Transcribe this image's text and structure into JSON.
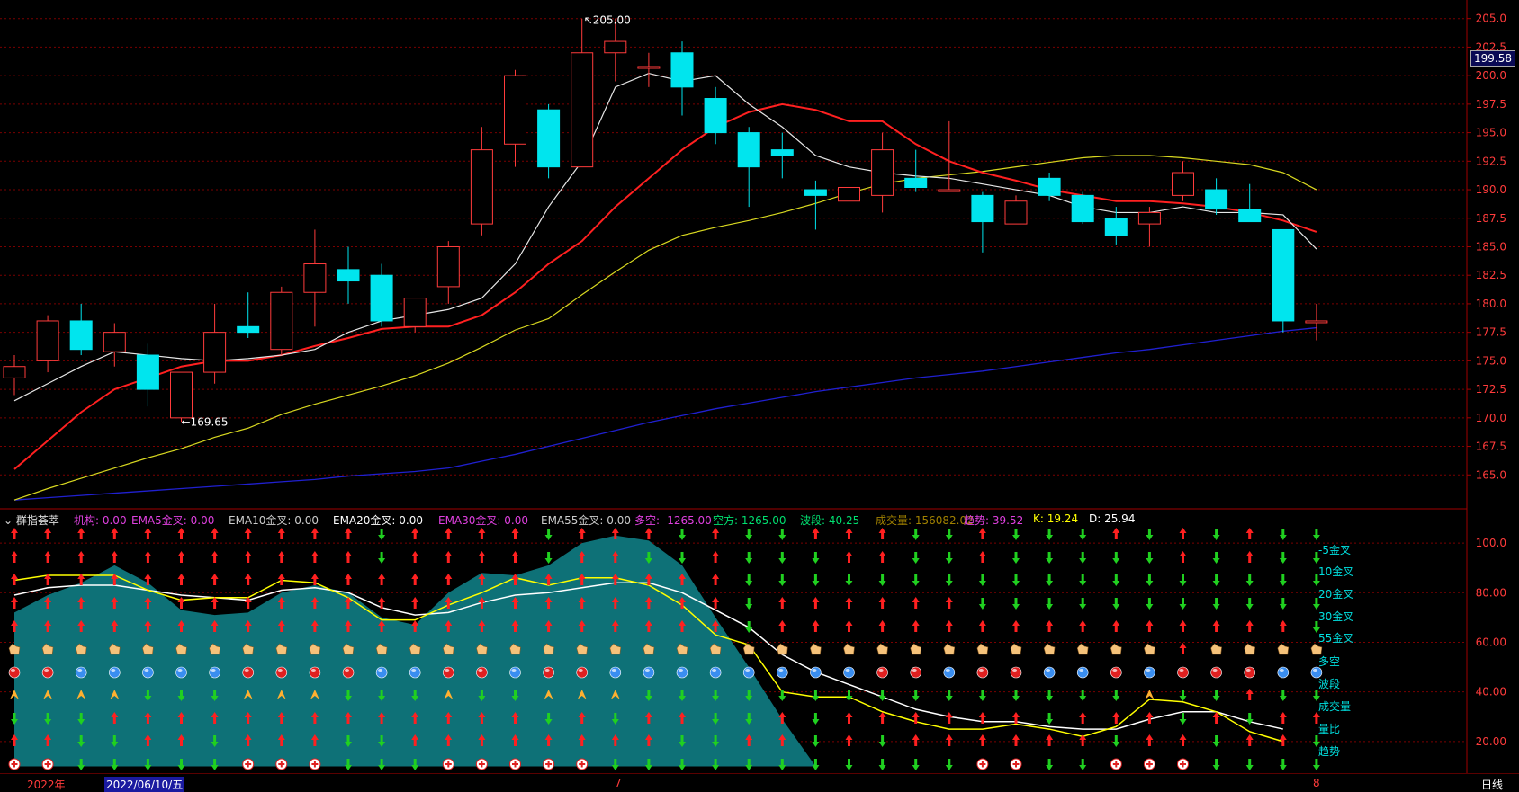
{
  "colors": {
    "up": "#ff3b3b",
    "down": "#00e5ee",
    "ma5": "#e6e6e6",
    "ma10": "#ff2020",
    "ma20": "#d8d820",
    "ma60": "#2020d0",
    "grid": "#7a0000"
  },
  "main": {
    "y_ticks": [
      "205.0",
      "202.5",
      "200.0",
      "197.5",
      "195.0",
      "192.5",
      "190.0",
      "187.5",
      "185.0",
      "182.5",
      "180.0",
      "177.5",
      "175.0",
      "172.5",
      "170.0",
      "167.5",
      "165.0"
    ],
    "current_price": "199.58",
    "high_label": "205.00",
    "low_label": "169.65",
    "high_arrow": "↖",
    "low_arrow": "←"
  },
  "legend": {
    "indicator_name": "群指荟萃",
    "items": [
      {
        "text": "机构: 0.00",
        "color": "#e040e0"
      },
      {
        "text": "EMA5金叉: 0.00",
        "color": "#e040e0"
      },
      {
        "text": "EMA10金叉: 0.00",
        "color": "#cccccc"
      },
      {
        "text": "EMA20金叉: 0.00",
        "color": "#ffffff"
      },
      {
        "text": "EMA30金叉: 0.00",
        "color": "#e040e0"
      },
      {
        "text": "EMA55金叉: 0.00",
        "color": "#cccccc"
      },
      {
        "text": "多空: -1265.00",
        "color": "#e040e0"
      },
      {
        "text": "空方: 1265.00",
        "color": "#00e070"
      },
      {
        "text": "波段: 40.25",
        "color": "#00e070"
      },
      {
        "text": "成交量: 156082.02",
        "color": "#a08000"
      },
      {
        "text": "趋势: 39.52",
        "color": "#e040e0"
      },
      {
        "text": "K: 19.24",
        "color": "#ffff00"
      },
      {
        "text": "D: 25.94",
        "color": "#ffffff"
      }
    ]
  },
  "sub": {
    "y_ticks": [
      "100.0",
      "80.00",
      "60.00",
      "40.00",
      "20.00"
    ],
    "row_labels": [
      "-5金叉",
      "10金叉",
      "20金叉",
      "30金叉",
      "55金叉",
      "多空",
      "波段",
      "成交量",
      "量比",
      "趋势"
    ],
    "row_label_color": "#00e0e0"
  },
  "bottom": {
    "year": "2022年",
    "date": "2022/06/10/五",
    "month7": "7",
    "month8": "8",
    "period": "日线"
  },
  "chart_data": [
    {
      "type": "candlestick",
      "ylim": [
        162.5,
        206.0
      ],
      "candles": [
        {
          "o": 173.5,
          "h": 175.5,
          "l": 172.0,
          "c": 174.5
        },
        {
          "o": 175.0,
          "h": 179.0,
          "l": 174.0,
          "c": 178.5
        },
        {
          "o": 178.5,
          "h": 180.0,
          "l": 175.5,
          "c": 176.0
        },
        {
          "o": 175.8,
          "h": 178.3,
          "l": 174.5,
          "c": 177.5
        },
        {
          "o": 175.5,
          "h": 176.5,
          "l": 171.0,
          "c": 172.5
        },
        {
          "o": 170.0,
          "h": 174.0,
          "l": 169.65,
          "c": 174.0
        },
        {
          "o": 174.0,
          "h": 180.0,
          "l": 173.0,
          "c": 177.5
        },
        {
          "o": 178.0,
          "h": 181.0,
          "l": 177.0,
          "c": 177.5
        },
        {
          "o": 176.0,
          "h": 181.5,
          "l": 175.5,
          "c": 181.0
        },
        {
          "o": 181.0,
          "h": 186.5,
          "l": 178.0,
          "c": 183.5
        },
        {
          "o": 183.0,
          "h": 185.0,
          "l": 180.0,
          "c": 182.0
        },
        {
          "o": 182.5,
          "h": 183.5,
          "l": 178.0,
          "c": 178.5
        },
        {
          "o": 178.0,
          "h": 180.5,
          "l": 177.5,
          "c": 180.5
        },
        {
          "o": 181.5,
          "h": 185.5,
          "l": 180.0,
          "c": 185.0
        },
        {
          "o": 187.0,
          "h": 195.5,
          "l": 186.0,
          "c": 193.5
        },
        {
          "o": 194.0,
          "h": 200.5,
          "l": 192.0,
          "c": 200.0
        },
        {
          "o": 197.0,
          "h": 197.5,
          "l": 191.0,
          "c": 192.0
        },
        {
          "o": 192.0,
          "h": 205.0,
          "l": 192.0,
          "c": 202.0
        },
        {
          "o": 202.0,
          "h": 205.0,
          "l": 199.5,
          "c": 203.0
        },
        {
          "o": 200.8,
          "h": 202.0,
          "l": 199.0,
          "c": 200.8
        },
        {
          "o": 202.0,
          "h": 203.0,
          "l": 196.5,
          "c": 199.0
        },
        {
          "o": 198.0,
          "h": 199.0,
          "l": 194.0,
          "c": 195.0
        },
        {
          "o": 195.0,
          "h": 195.5,
          "l": 188.5,
          "c": 192.0
        },
        {
          "o": 193.5,
          "h": 195.0,
          "l": 191.0,
          "c": 193.0
        },
        {
          "o": 190.0,
          "h": 190.8,
          "l": 186.5,
          "c": 189.5
        },
        {
          "o": 189.0,
          "h": 191.5,
          "l": 188.0,
          "c": 190.2
        },
        {
          "o": 189.5,
          "h": 195.0,
          "l": 188.0,
          "c": 193.5
        },
        {
          "o": 191.0,
          "h": 193.5,
          "l": 189.8,
          "c": 190.2
        },
        {
          "o": 190.0,
          "h": 196.0,
          "l": 190.0,
          "c": 190.0
        },
        {
          "o": 189.5,
          "h": 189.8,
          "l": 184.5,
          "c": 187.2
        },
        {
          "o": 187.0,
          "h": 189.5,
          "l": 187.0,
          "c": 189.0
        },
        {
          "o": 191.0,
          "h": 191.5,
          "l": 189.0,
          "c": 189.5
        },
        {
          "o": 189.5,
          "h": 189.8,
          "l": 187.0,
          "c": 187.2
        },
        {
          "o": 187.5,
          "h": 188.5,
          "l": 185.2,
          "c": 186.0
        },
        {
          "o": 187.0,
          "h": 188.5,
          "l": 185.0,
          "c": 188.0
        },
        {
          "o": 189.5,
          "h": 192.5,
          "l": 189.0,
          "c": 191.5
        },
        {
          "o": 190.0,
          "h": 191.0,
          "l": 187.8,
          "c": 188.3
        },
        {
          "o": 188.3,
          "h": 190.5,
          "l": 187.2,
          "c": 187.2
        },
        {
          "o": 186.5,
          "h": 186.5,
          "l": 177.5,
          "c": 178.5
        },
        {
          "o": 178.5,
          "h": 180.0,
          "l": 176.8,
          "c": 178.5
        }
      ],
      "ma5": [
        171.5,
        173.0,
        174.5,
        175.8,
        175.5,
        175.2,
        175.0,
        175.2,
        175.5,
        176.0,
        177.5,
        178.5,
        179.0,
        179.5,
        180.5,
        183.5,
        188.5,
        192.5,
        199.0,
        200.2,
        199.5,
        200.0,
        197.5,
        195.5,
        193.0,
        192.0,
        191.5,
        191.2,
        191.0,
        190.5,
        190.0,
        189.5,
        188.5,
        188.0,
        188.0,
        188.5,
        188.0,
        188.0,
        187.8,
        184.8
      ],
      "ma10": [
        165.5,
        168.0,
        170.5,
        172.5,
        173.5,
        174.5,
        175.0,
        175.0,
        175.5,
        176.3,
        177.0,
        177.8,
        178.0,
        178.0,
        179.0,
        181.0,
        183.5,
        185.5,
        188.5,
        191.0,
        193.5,
        195.5,
        196.8,
        197.5,
        197.0,
        196.0,
        196.0,
        194.0,
        192.5,
        191.5,
        190.8,
        190.0,
        189.5,
        189.0,
        189.0,
        188.8,
        188.5,
        188.0,
        187.3,
        186.3
      ],
      "ma20": [
        162.8,
        163.8,
        164.7,
        165.6,
        166.5,
        167.3,
        168.3,
        169.1,
        170.3,
        171.2,
        172.0,
        172.8,
        173.7,
        174.8,
        176.2,
        177.7,
        178.7,
        180.8,
        182.8,
        184.7,
        186.0,
        186.7,
        187.3,
        188.0,
        188.8,
        189.7,
        190.5,
        191.0,
        191.3,
        191.6,
        192.0,
        192.4,
        192.8,
        193.0,
        193.0,
        192.8,
        192.5,
        192.2,
        191.5,
        190.0
      ],
      "ma60": [
        162.8,
        163.0,
        163.2,
        163.4,
        163.6,
        163.8,
        164.0,
        164.2,
        164.4,
        164.6,
        164.9,
        165.1,
        165.3,
        165.6,
        166.2,
        166.8,
        167.5,
        168.2,
        168.9,
        169.6,
        170.2,
        170.8,
        171.3,
        171.8,
        172.3,
        172.7,
        173.1,
        173.5,
        173.8,
        174.1,
        174.5,
        174.9,
        175.3,
        175.7,
        176.0,
        176.4,
        176.8,
        177.2,
        177.6,
        177.9
      ]
    },
    {
      "type": "area",
      "ylim": [
        8,
        108
      ],
      "area": [
        72,
        79,
        84,
        91,
        84,
        73,
        71,
        72,
        80,
        83,
        80,
        70,
        67,
        80,
        88,
        87,
        91,
        100,
        103,
        101,
        91,
        70,
        50,
        29,
        10,
        null,
        null,
        null,
        null,
        null,
        null,
        null,
        null,
        null,
        null,
        null,
        null,
        null,
        null,
        null
      ],
      "k": [
        85,
        87,
        87,
        87,
        81,
        77,
        78,
        78,
        85,
        84,
        78,
        69,
        69,
        75,
        80,
        86,
        83,
        86,
        86,
        83,
        75,
        63,
        59,
        40,
        38,
        38,
        32,
        28,
        25,
        25,
        27,
        25,
        22,
        26,
        37,
        36,
        32,
        24,
        20,
        null
      ],
      "d": [
        79,
        82,
        83,
        83,
        81,
        79,
        78,
        77,
        81,
        82,
        80,
        74,
        71,
        72,
        76,
        79,
        80,
        82,
        84,
        84,
        80,
        73,
        66,
        55,
        48,
        43,
        38,
        33,
        30,
        28,
        28,
        26,
        25,
        25,
        29,
        32,
        32,
        28,
        25,
        null
      ],
      "signal_rows": [
        [
          "u",
          "u",
          "u",
          "u",
          "u",
          "u",
          "u",
          "u",
          "u",
          "u",
          "u",
          "d",
          "u",
          "u",
          "u",
          "u",
          "d",
          "u",
          "u",
          "u",
          "d",
          "u",
          "d",
          "d",
          "u",
          "u",
          "u",
          "d",
          "d",
          "u",
          "d",
          "d",
          "d",
          "u",
          "d",
          "u",
          "d",
          "u",
          "d",
          "d"
        ],
        [
          "u",
          "u",
          "u",
          "u",
          "u",
          "u",
          "u",
          "u",
          "u",
          "u",
          "u",
          "d",
          "u",
          "u",
          "u",
          "u",
          "d",
          "u",
          "u",
          "d",
          "d",
          "u",
          "d",
          "d",
          "d",
          "u",
          "u",
          "d",
          "d",
          "u",
          "d",
          "d",
          "d",
          "d",
          "d",
          "u",
          "d",
          "u",
          "d",
          "d"
        ],
        [
          "u",
          "u",
          "u",
          "u",
          "u",
          "u",
          "u",
          "u",
          "u",
          "u",
          "u",
          "u",
          "u",
          "u",
          "u",
          "u",
          "u",
          "u",
          "u",
          "u",
          "u",
          "u",
          "d",
          "d",
          "d",
          "d",
          "d",
          "d",
          "d",
          "d",
          "d",
          "d",
          "d",
          "d",
          "d",
          "d",
          "d",
          "d",
          "d",
          "d"
        ],
        [
          "u",
          "u",
          "u",
          "u",
          "u",
          "u",
          "u",
          "u",
          "u",
          "u",
          "u",
          "u",
          "u",
          "u",
          "u",
          "u",
          "u",
          "u",
          "u",
          "u",
          "u",
          "u",
          "d",
          "u",
          "u",
          "u",
          "u",
          "u",
          "u",
          "d",
          "d",
          "d",
          "d",
          "d",
          "d",
          "d",
          "d",
          "d",
          "d",
          "d"
        ],
        [
          "u",
          "u",
          "u",
          "u",
          "u",
          "u",
          "u",
          "u",
          "u",
          "u",
          "u",
          "u",
          "u",
          "u",
          "u",
          "u",
          "u",
          "u",
          "u",
          "u",
          "u",
          "u",
          "d",
          "u",
          "u",
          "u",
          "u",
          "u",
          "u",
          "u",
          "u",
          "u",
          "u",
          "u",
          "u",
          "u",
          "u",
          "u",
          "u",
          "d"
        ],
        [
          "h",
          "h",
          "h",
          "h",
          "h",
          "h",
          "h",
          "h",
          "h",
          "h",
          "h",
          "h",
          "h",
          "h",
          "h",
          "h",
          "h",
          "h",
          "h",
          "h",
          "h",
          "h",
          "h",
          "h",
          "h",
          "h",
          "h",
          "h",
          "h",
          "h",
          "h",
          "h",
          "h",
          "h",
          "h",
          "u",
          "h",
          "h",
          "h",
          "h"
        ],
        [
          "r",
          "r",
          "b",
          "b",
          "b",
          "b",
          "b",
          "r",
          "r",
          "r",
          "r",
          "b",
          "b",
          "r",
          "r",
          "b",
          "r",
          "r",
          "b",
          "b",
          "b",
          "b",
          "b",
          "b",
          "b",
          "b",
          "r",
          "r",
          "b",
          "r",
          "r",
          "b",
          "b",
          "r",
          "b",
          "r",
          "r",
          "r",
          "b",
          "b"
        ],
        [
          "f",
          "f",
          "f",
          "f",
          "d",
          "d",
          "d",
          "f",
          "f",
          "f",
          "d",
          "d",
          "d",
          "f",
          "d",
          "d",
          "f",
          "f",
          "f",
          "d",
          "d",
          "d",
          "d",
          "d",
          "d",
          "d",
          "d",
          "d",
          "d",
          "d",
          "d",
          "d",
          "d",
          "d",
          "f",
          "d",
          "d",
          "u",
          "d",
          "d"
        ],
        [
          "d",
          "d",
          "d",
          "u",
          "u",
          "u",
          "u",
          "u",
          "u",
          "u",
          "u",
          "u",
          "u",
          "u",
          "u",
          "u",
          "d",
          "u",
          "d",
          "u",
          "u",
          "d",
          "d",
          "u",
          "d",
          "u",
          "u",
          "u",
          "u",
          "u",
          "u",
          "d",
          "u",
          "u",
          "u",
          "d",
          "u",
          "d",
          "u",
          "u"
        ],
        [
          "u",
          "u",
          "d",
          "d",
          "u",
          "u",
          "d",
          "u",
          "u",
          "u",
          "d",
          "d",
          "u",
          "u",
          "u",
          "u",
          "u",
          "u",
          "u",
          "u",
          "d",
          "d",
          "u",
          "u",
          "d",
          "u",
          "d",
          "u",
          "u",
          "u",
          "u",
          "u",
          "u",
          "d",
          "u",
          "u",
          "d",
          "u",
          "u",
          "d"
        ],
        [
          "p",
          "p",
          "d",
          "d",
          "d",
          "d",
          "d",
          "p",
          "p",
          "p",
          "d",
          "d",
          "d",
          "p",
          "p",
          "p",
          "p",
          "p",
          "d",
          "d",
          "d",
          "d",
          "d",
          "d",
          "d",
          "d",
          "d",
          "d",
          "d",
          "p",
          "p",
          "d",
          "d",
          "p",
          "p",
          "p",
          "d",
          "d",
          "d",
          "d"
        ]
      ]
    }
  ]
}
